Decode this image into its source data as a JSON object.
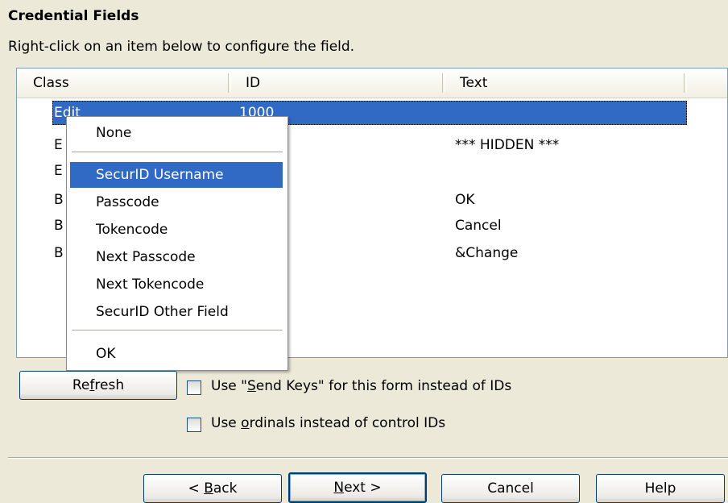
{
  "section_title": "Credential Fields",
  "instruction": "Right-click on an item below to configure the field.",
  "listview": {
    "columns": [
      "Class",
      "ID",
      "Text"
    ],
    "rows": [
      {
        "class": "Edit",
        "id": "1000",
        "text": "",
        "selected": true
      },
      {
        "class": "E",
        "id": "",
        "text": "*** HIDDEN ***"
      },
      {
        "class": "E",
        "id": "",
        "text": ""
      },
      {
        "class": "B",
        "id": "",
        "text": "OK"
      },
      {
        "class": "B",
        "id": "",
        "text": "Cancel"
      },
      {
        "class": "B",
        "id": "",
        "text": "&Change"
      }
    ]
  },
  "context_menu": {
    "items": [
      "None",
      "SecurID Username",
      "Passcode",
      "Tokencode",
      "Next Passcode",
      "Next Tokencode",
      "SecurID Other Field",
      "OK"
    ],
    "highlighted": "SecurID Username"
  },
  "refresh_button": {
    "pre": "Re",
    "accel": "f",
    "post": "resh"
  },
  "checkbox_send_keys": {
    "pre": "Use \"",
    "accel": "S",
    "post": "end Keys\" for this form instead of IDs",
    "checked": false
  },
  "checkbox_ordinals": {
    "pre": "Use ",
    "accel": "o",
    "post": "rdinals instead of control IDs",
    "checked": false
  },
  "nav_buttons": {
    "back": {
      "pre": "< ",
      "accel": "B",
      "post": "ack"
    },
    "next": {
      "pre": "",
      "accel": "N",
      "post": "ext >"
    },
    "cancel": "Cancel",
    "help": "Help"
  },
  "colors": {
    "selection": "#316ac5",
    "dialog_bg": "#ece9d8"
  }
}
